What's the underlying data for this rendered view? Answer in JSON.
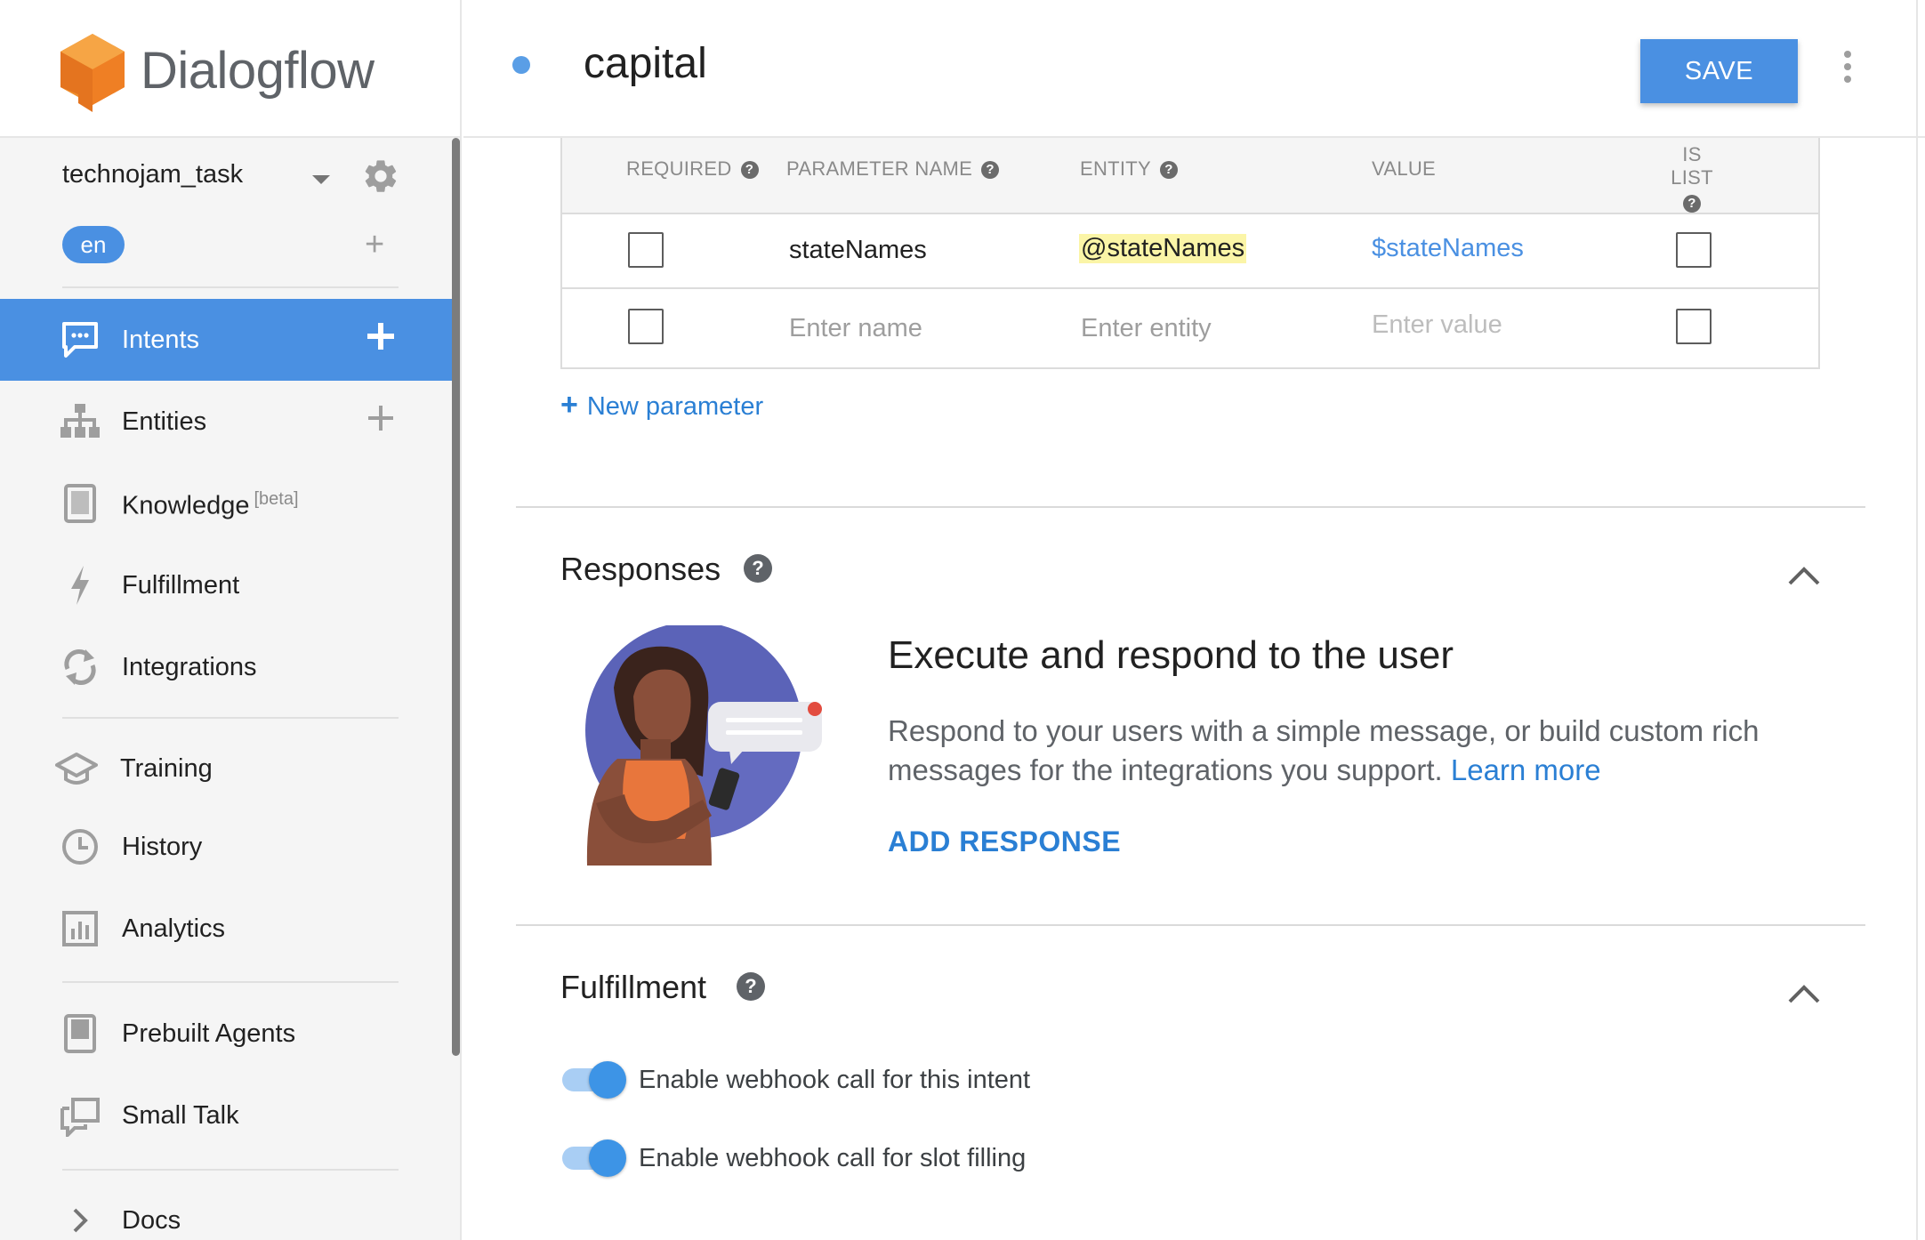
{
  "app": {
    "name": "Dialogflow"
  },
  "agent": {
    "name": "technojam_task",
    "language": "en"
  },
  "sidebar": {
    "items": [
      {
        "label": "Intents",
        "active": true,
        "icon": "chat-icon"
      },
      {
        "label": "Entities",
        "icon": "hierarchy-icon"
      },
      {
        "label": "Knowledge",
        "badge": "[beta]",
        "icon": "book-icon"
      },
      {
        "label": "Fulfillment",
        "icon": "bolt-icon"
      },
      {
        "label": "Integrations",
        "icon": "sync-icon"
      },
      {
        "label": "Training",
        "icon": "graduation-cap-icon"
      },
      {
        "label": "History",
        "icon": "clock-icon"
      },
      {
        "label": "Analytics",
        "icon": "bar-chart-icon"
      },
      {
        "label": "Prebuilt Agents",
        "icon": "agent-book-icon"
      },
      {
        "label": "Small Talk",
        "icon": "chat-bubbles-icon"
      },
      {
        "label": "Docs",
        "icon": "chevron-right-icon"
      }
    ]
  },
  "header": {
    "title": "capital",
    "save_label": "SAVE"
  },
  "parameters": {
    "columns": {
      "required": "REQUIRED",
      "name": "PARAMETER NAME",
      "entity": "ENTITY",
      "value": "VALUE",
      "is_list": "IS LIST"
    },
    "rows": [
      {
        "required": false,
        "name": "stateNames",
        "entity": "@stateNames",
        "value": "$stateNames",
        "is_list": false
      }
    ],
    "placeholders": {
      "name": "Enter name",
      "entity": "Enter entity",
      "value": "Enter value"
    },
    "new_label": "New parameter"
  },
  "responses": {
    "title": "Responses",
    "heading": "Execute and respond to the user",
    "description": "Respond to your users with a simple message, or build custom rich messages for the integrations you support.",
    "learn_more": "Learn more",
    "add_label": "ADD RESPONSE"
  },
  "fulfillment": {
    "title": "Fulfillment",
    "toggles": [
      {
        "label": "Enable webhook call for this intent",
        "on": true
      },
      {
        "label": "Enable webhook call for slot filling",
        "on": true
      }
    ]
  },
  "colors": {
    "accent": "#4a90e2",
    "link": "#2a7fd4",
    "highlight": "#fbf5a7"
  }
}
